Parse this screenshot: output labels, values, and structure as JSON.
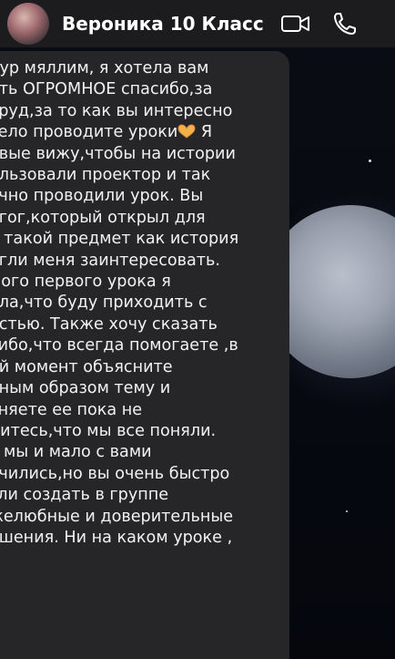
{
  "header": {
    "contact_name": "Вероника 10 Класс",
    "icons": [
      "video-call-icon",
      "phone-call-icon"
    ]
  },
  "colors": {
    "header_bg": "#1c1c1e",
    "bubble_bg": "#262628",
    "text": "#f2f2f2",
    "icon": "#ffffff"
  },
  "message": {
    "lines": [
      "нур мяллим, я хотела вам",
      "ать ОГРОМНОЕ спасибо,за",
      " труд,за то как вы интересно",
      "село проводите уроки",
      "овые вижу,чтобы на истории",
      "ользовали проектор и так",
      "учно проводили урок. Вы",
      "агог,который открыл для",
      "я такой предмет как история",
      "огли меня заинтересовать.",
      "мого первого урока я",
      "ала,что буду приходить с",
      "остью. Также хочу сказать",
      "сибо,что всегда помогаете ,в",
      "ой момент объясните",
      "кным образом тему и",
      "сняете ее пока не",
      "дитесь,что мы все поняли.",
      "ь мы и мало с вами",
      "учились,но вы очень быстро",
      "гли создать в группе",
      "желюбные и доверительные",
      "ошения. Ни на каком уроке ,"
    ],
    "line4_suffix": " Я",
    "emoji_name": "heart-hands-emoji"
  }
}
